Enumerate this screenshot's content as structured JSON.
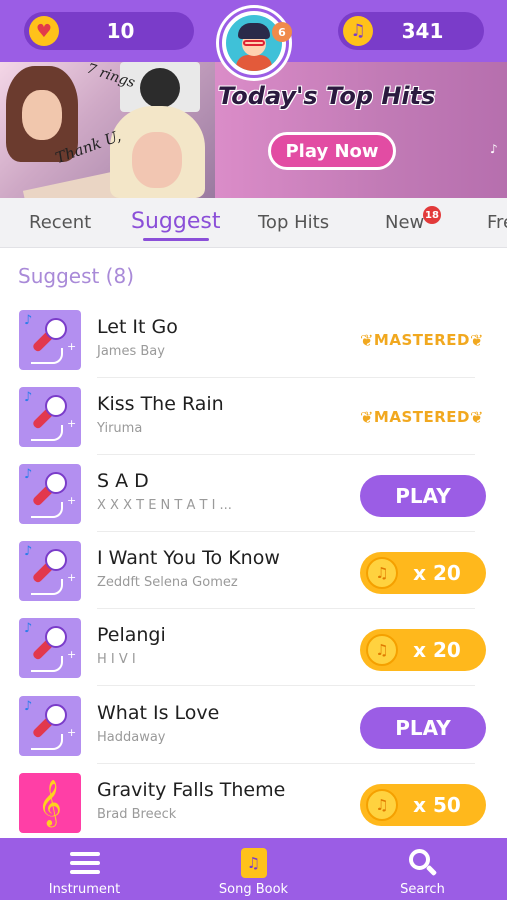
{
  "header": {
    "lives": "10",
    "notes": "341",
    "avatar_badge": "6",
    "colors": {
      "bar": "#9b5de5",
      "pill": "#7a3cc9",
      "coin": "#ffc21a"
    }
  },
  "banner": {
    "headline": "Today's Top Hits",
    "cta_label": "Play Now",
    "collage_text_1": "7 rings",
    "collage_text_2": "Thank U,"
  },
  "tabs": {
    "items": [
      {
        "label": "Recent"
      },
      {
        "label": "Suggest"
      },
      {
        "label": "Top Hits"
      },
      {
        "label": "New"
      },
      {
        "label": "Fre"
      }
    ],
    "active": "Suggest",
    "new_badge": "18",
    "accent": "#8b4fd8"
  },
  "section": {
    "title": "Suggest (8)"
  },
  "songs": [
    {
      "title": "Let It Go",
      "artist": "James Bay",
      "action": "mastered",
      "action_label": "MASTERED"
    },
    {
      "title": "Kiss The Rain",
      "artist": "Yiruma",
      "action": "mastered",
      "action_label": "MASTERED"
    },
    {
      "title": "S A D",
      "artist": "X X X T E N T A T I ...",
      "action": "play",
      "action_label": "PLAY"
    },
    {
      "title": "I Want You To Know",
      "artist": "Zeddft Selena Gomez",
      "action": "cost",
      "action_label": "x 20"
    },
    {
      "title": "Pelangi",
      "artist": "H I V I",
      "action": "cost",
      "action_label": "x 20"
    },
    {
      "title": "What Is Love",
      "artist": "Haddaway",
      "action": "play",
      "action_label": "PLAY"
    },
    {
      "title": "Gravity Falls Theme",
      "artist": "Brad Breeck",
      "action": "cost",
      "action_label": "x 50"
    }
  ],
  "bottom_nav": {
    "items": [
      {
        "label": "Instrument",
        "icon": "menu-icon"
      },
      {
        "label": "Song Book",
        "icon": "songbook-icon"
      },
      {
        "label": "Search",
        "icon": "search-icon"
      }
    ]
  }
}
